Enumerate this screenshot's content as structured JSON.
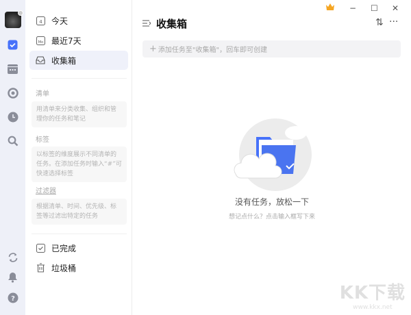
{
  "window": {
    "crown_icon": "crown-icon",
    "minimize": "−",
    "maximize": "☐",
    "close": "✕"
  },
  "sidebar": {
    "nav": [
      {
        "label": "今天",
        "icon_text": "4"
      },
      {
        "label": "最近7天",
        "icon_text": "Mo"
      },
      {
        "label": "收集箱"
      }
    ],
    "sections": [
      {
        "title": "清单",
        "hint": "用清单来分类收集、组织和管理你的任务和笔记"
      },
      {
        "title": "标签",
        "hint": "以标签的维度展示不同清单的任务。在添加任务时输入“#”可快速选择标签"
      },
      {
        "title": "过滤器",
        "hint": "根据清单、时间、优先级、标签等过滤出特定的任务"
      }
    ],
    "bottom": [
      {
        "label": "已完成"
      },
      {
        "label": "垃圾桶"
      }
    ]
  },
  "main": {
    "title": "收集箱",
    "add_placeholder": "添加任务至\"收集箱\"，回车即可创建",
    "empty_title": "没有任务，放松一下",
    "empty_sub": "想记点什么？点击输入框写下来",
    "more": "···",
    "sort": "⇅"
  },
  "watermark": {
    "brand": "KK下载",
    "url": "www.kkx.net"
  },
  "colors": {
    "accent": "#4772fa",
    "rail": "#eef0f8"
  }
}
